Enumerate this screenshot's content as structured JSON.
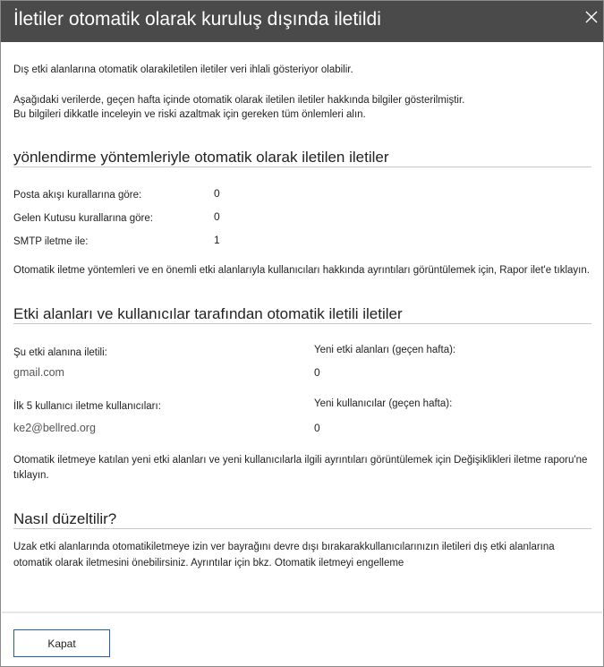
{
  "dialog": {
    "title": "İletiler otomatik olarak kuruluş dışında iletildi",
    "close_icon": "close-icon"
  },
  "intro": {
    "line1": "Dış etki alanlarına otomatik olarakiletilen iletiler veri ihlali gösteriyor olabilir.",
    "line2": "Aşağıdaki verilerde, geçen hafta içinde otomatik olarak iletilen iletiler hakkında bilgiler gösterilmiştir.",
    "line3": "Bu bilgileri dikkatle inceleyin ve riski azaltmak için gereken tüm önlemleri alın."
  },
  "methods": {
    "heading": "yönlendirme yöntemleriyle otomatik olarak iletilen iletiler",
    "rows": [
      {
        "label": "Posta akışı kurallarına göre:",
        "value": "0"
      },
      {
        "label": "Gelen Kutusu kurallarına göre:",
        "value": "0"
      },
      {
        "label": "SMTP iletme ile:",
        "value": "1"
      }
    ],
    "note": "Otomatik iletme yöntemleri ve en önemli etki alanlarıyla kullanıcıları hakkında ayrıntıları görüntülemek için, Rapor ilet'e tıklayın."
  },
  "domains": {
    "heading": "Etki alanları ve kullanıcılar tarafından otomatik iletili iletiler",
    "forwarded_label": "Şu etki alanına iletili:",
    "forwarded_value": "gmail.com",
    "new_domains_label": "Yeni etki alanları (geçen hafta):",
    "new_domains_value": "0",
    "top_users_label": "İlk 5 kullanıcı iletme kullanıcıları:",
    "top_users_value": "ke2@bellred.org",
    "new_users_label": "Yeni kullanıcılar (geçen hafta):",
    "new_users_value": "0",
    "note_line1": "Otomatik iletmeye katılan yeni etki alanları ve yeni kullanıcılarla ilgili ayrıntıları görüntülemek için Değişiklikleri iletme raporu'ne",
    "note_line2": "tıklayın."
  },
  "fix": {
    "heading": "Nasıl düzeltilir?",
    "line1": "Uzak etki alanlarında otomatikiletmeye izin ver bayrağını devre dışı bırakarakkullanıcılarınızın iletileri dış etki alanlarına",
    "line2": "otomatik olarak iletmesini önebilirsiniz. Ayrıntılar için bkz. Otomatik iletmeyi engelleme"
  },
  "footer": {
    "close_button": "Kapat"
  }
}
